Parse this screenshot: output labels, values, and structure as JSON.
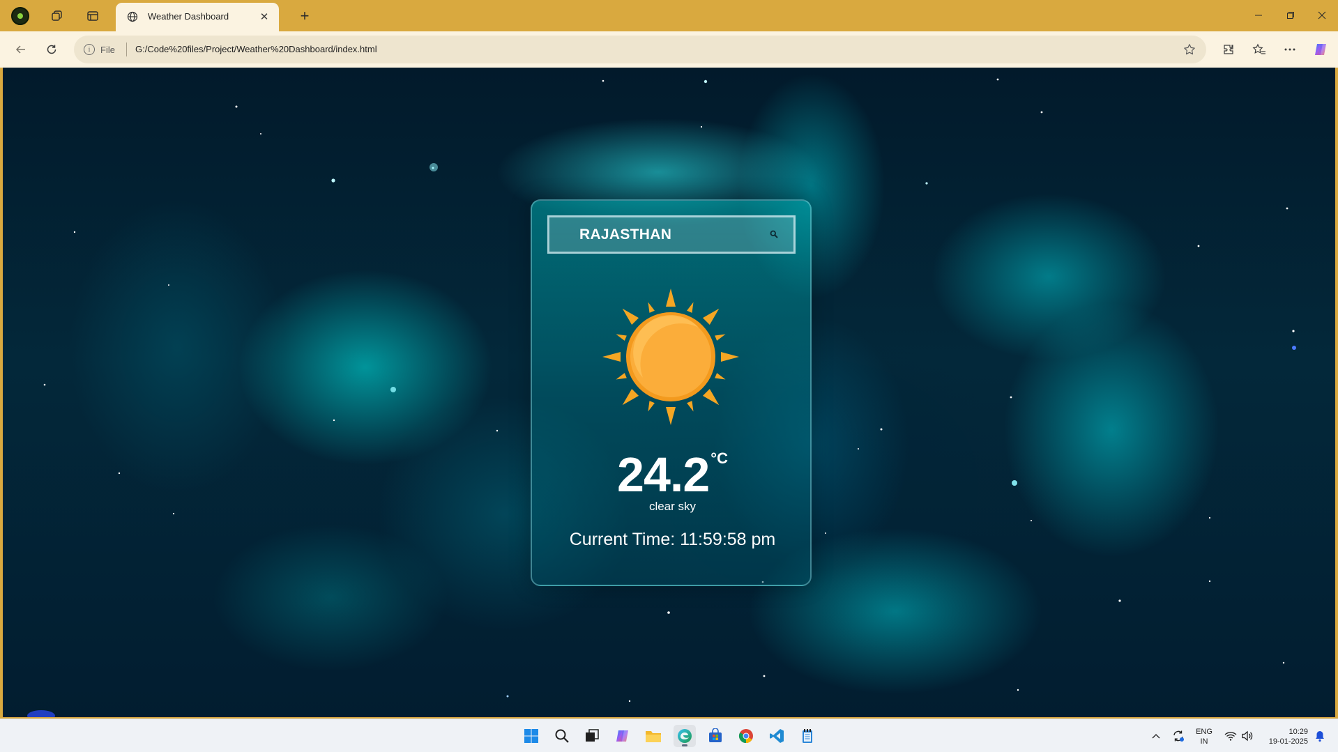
{
  "browser": {
    "tab": {
      "title": "Weather Dashboard"
    },
    "address": {
      "scheme_label": "File",
      "url": "G:/Code%20files/Project/Weather%20Dashboard/index.html"
    }
  },
  "weather": {
    "search": {
      "value": "RAJASTHAN"
    },
    "temperature": "24.2",
    "unit": "°C",
    "description": "clear sky",
    "current_time": "Current Time: 11:59:58 pm"
  },
  "taskbar": {
    "language": {
      "line1": "ENG",
      "line2": "IN"
    },
    "clock": {
      "time": "10:29",
      "date": "19-01-2025"
    }
  },
  "colors": {
    "titlebar": "#d9a93f",
    "toolbar": "#fbf3e1",
    "card_border": "#8cd7e1",
    "sun_core": "#fbad3a",
    "sun_rays": "#f5a623"
  },
  "icons": [
    "profile-icon",
    "workspaces-icon",
    "tab-actions-icon",
    "globe-icon",
    "close-icon",
    "plus-icon",
    "minimize-icon",
    "restore-icon",
    "back-icon",
    "refresh-icon",
    "info-icon",
    "star-icon",
    "extensions-icon",
    "favorites-icon",
    "more-icon",
    "copilot-icon",
    "search-icon",
    "sun-icon",
    "windows-start-icon",
    "task-view-icon",
    "file-explorer-icon",
    "edge-icon",
    "store-icon",
    "chrome-icon",
    "vscode-icon",
    "notepad-icon",
    "wifi-icon",
    "volume-icon",
    "bell-icon"
  ]
}
